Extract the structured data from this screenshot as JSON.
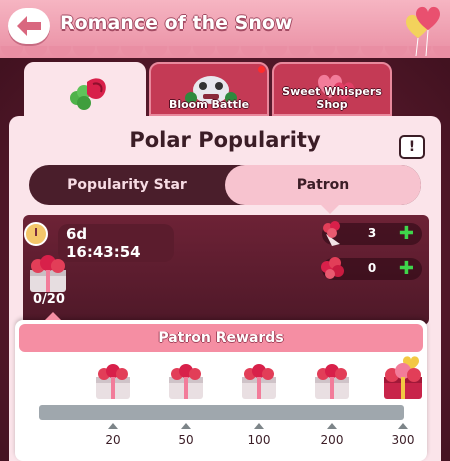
{
  "header": {
    "title": "Romance of the Snow"
  },
  "tabs": [
    {
      "label": ""
    },
    {
      "label": "Bloom Battle"
    },
    {
      "label": "Sweet Whispers Shop"
    }
  ],
  "panel": {
    "title": "Polar Popularity",
    "info_glyph": "!",
    "switch": {
      "left": "Popularity Star",
      "right": "Patron",
      "selected": "Patron"
    },
    "timer": "6d 16:43:54",
    "progress": "0/20",
    "resources": [
      {
        "icon": "bouquet-icon",
        "count": "3"
      },
      {
        "icon": "rose-bunch-icon",
        "count": "0"
      }
    ]
  },
  "rewards": {
    "title": "Patron Rewards",
    "milestones": [
      "20",
      "50",
      "100",
      "200",
      "300"
    ],
    "progress_fraction": 0
  },
  "colors": {
    "accent_pink": "#f58ea3",
    "panel_bg": "#fbe4ea",
    "dark_bg": "#54182a",
    "plus_green": "#3fd64b"
  }
}
